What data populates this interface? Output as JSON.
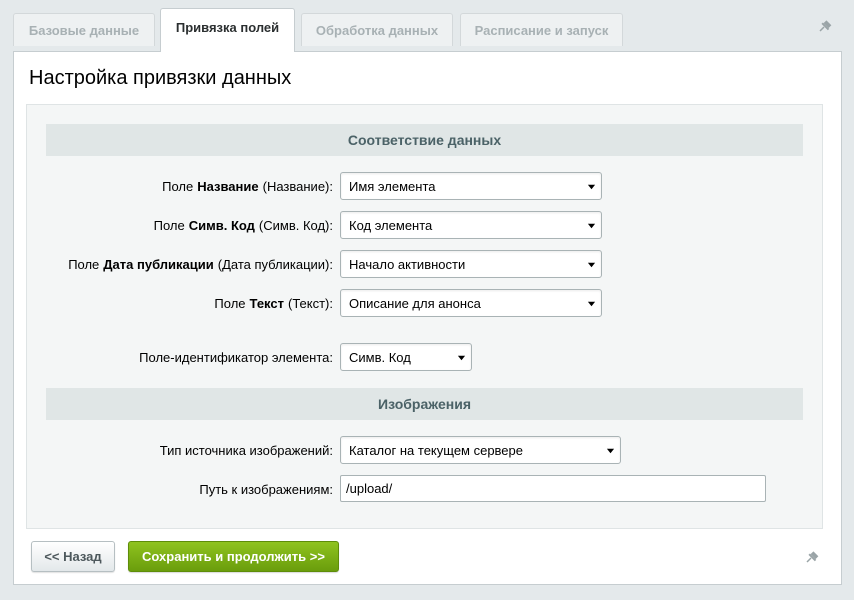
{
  "tabs": [
    {
      "label": "Базовые данные",
      "active": false
    },
    {
      "label": "Привязка полей",
      "active": true
    },
    {
      "label": "Обработка данных",
      "active": false
    },
    {
      "label": "Расписание и запуск",
      "active": false
    }
  ],
  "page_title": "Настройка привязки данных",
  "sections": {
    "mapping": {
      "title": "Соответствие данных",
      "fields": [
        {
          "prefix": "Поле",
          "name": "Название",
          "suffix": "(Название):",
          "value": "Имя элемента"
        },
        {
          "prefix": "Поле",
          "name": "Симв. Код",
          "suffix": "(Симв. Код):",
          "value": "Код элемента"
        },
        {
          "prefix": "Поле",
          "name": "Дата публикации",
          "suffix": "(Дата публикации):",
          "value": "Начало активности"
        },
        {
          "prefix": "Поле",
          "name": "Текст",
          "suffix": "(Текст):",
          "value": "Описание для анонса"
        }
      ],
      "identifier": {
        "label": "Поле-идентификатор элемента:",
        "value": "Симв. Код"
      }
    },
    "images": {
      "title": "Изображения",
      "source_type": {
        "label": "Тип источника изображений:",
        "value": "Каталог на текущем сервере"
      },
      "path": {
        "label": "Путь к изображениям:",
        "value": "/upload/"
      }
    }
  },
  "buttons": {
    "back": "<< Назад",
    "save": "Сохранить и продолжить >>"
  },
  "colors": {
    "accent_green": "#7cb116",
    "section_header_text": "#4b6267"
  },
  "icons": {
    "pin": "pin-icon",
    "dropdown": "caret-down-icon"
  }
}
